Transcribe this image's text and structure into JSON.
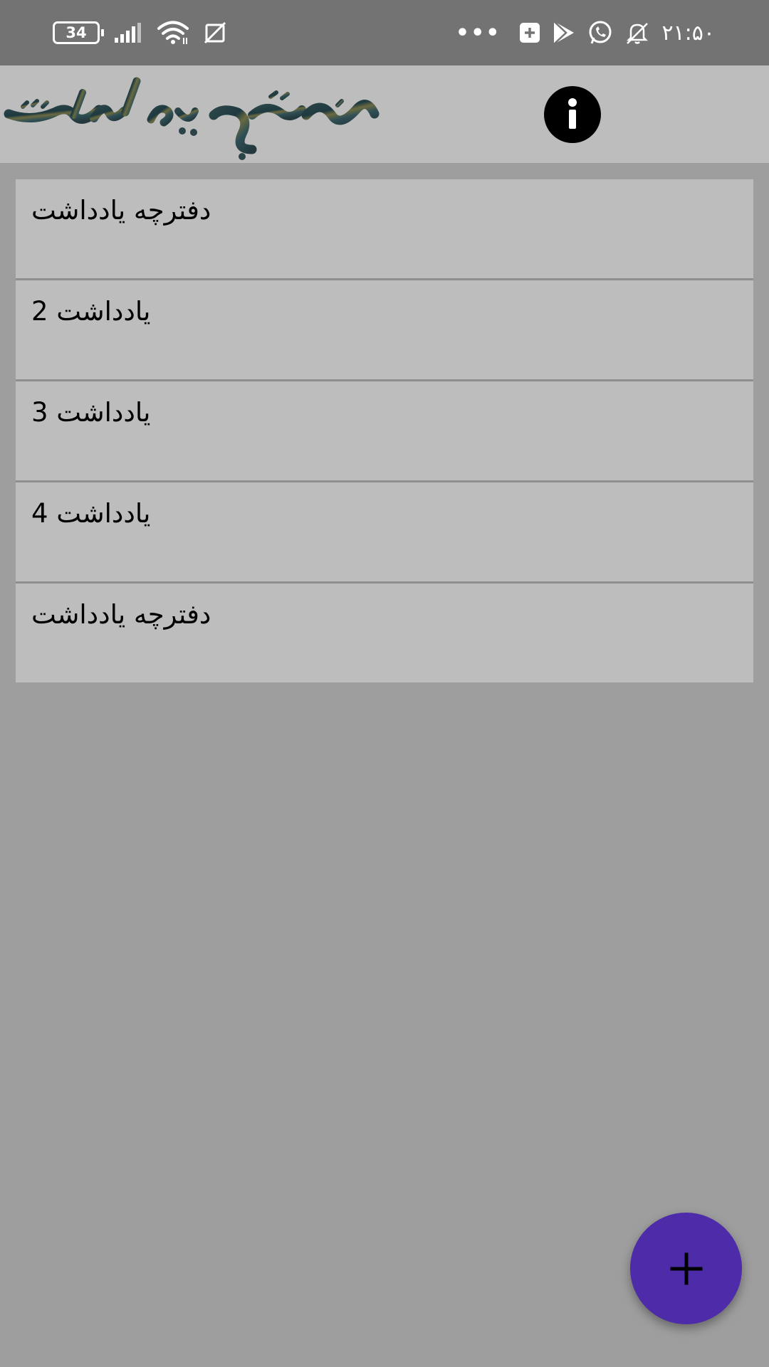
{
  "status_bar": {
    "battery_level": "34",
    "time": "۲۱:۵۰",
    "more_indicator": "•••",
    "left_icons": [
      "battery-icon",
      "signal-icon",
      "wifi-icon",
      "no-sim-icon"
    ],
    "right_icons": [
      "more-notifications-icon",
      "add-box-icon",
      "play-store-icon",
      "whatsapp-icon",
      "silent-icon"
    ]
  },
  "app_bar": {
    "logo_text": "دفترچه یادداشت",
    "info_icon": "info-icon"
  },
  "notes": [
    {
      "title": "دفترچه یادداشت"
    },
    {
      "title": "یادداشت 2"
    },
    {
      "title": "یادداشت 3"
    },
    {
      "title": "یادداشت 4"
    },
    {
      "title": "دفترچه یادداشت"
    }
  ],
  "fab": {
    "icon": "plus-icon"
  },
  "colors": {
    "status_bar": "#737373",
    "app_bar": "#bdbdbd",
    "background": "#9e9e9e",
    "list_item": "#bdbdbd",
    "fab": "#4e2ba8"
  }
}
